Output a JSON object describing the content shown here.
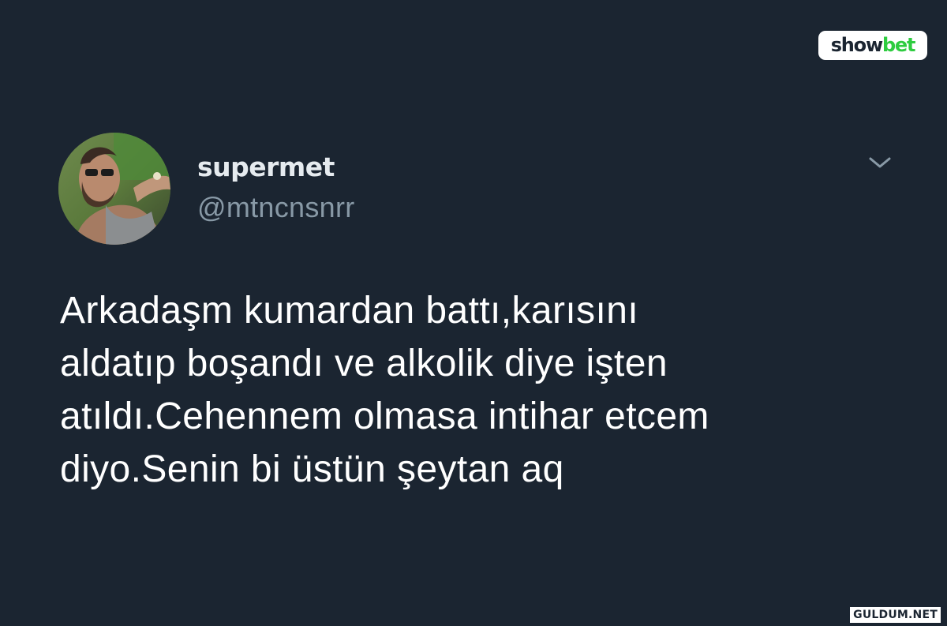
{
  "brand": {
    "part1": "show",
    "part2": "bet"
  },
  "tweet": {
    "display_name": "supermet",
    "handle": "@mtncnsnrr",
    "avatar_icon": "user-avatar-photo",
    "menu_icon": "chevron-down-icon",
    "text_lines": [
      "Arkadaşm kumardan battı,karısını",
      "aldatıp boşandı ve alkolik diye işten",
      "atıldı.Cehennem olmasa intihar etcem",
      "diyo.Senin bi üstün şeytan aq"
    ]
  },
  "watermark": {
    "text": "GULDUM.NET"
  },
  "colors": {
    "background": "#1b2531",
    "brand_green": "#2ecc40",
    "handle_gray": "#8899a6"
  }
}
